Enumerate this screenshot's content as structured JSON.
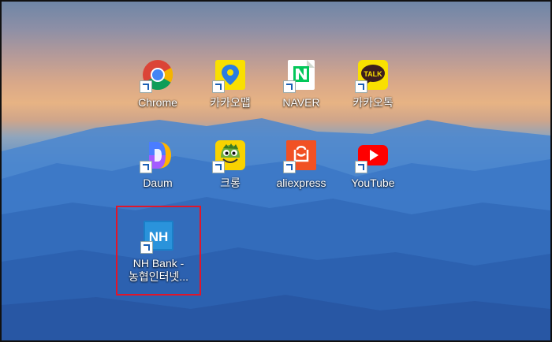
{
  "desktop": {
    "icons": [
      {
        "label": "Chrome",
        "icon": "chrome-icon"
      },
      {
        "label": "카카오맵",
        "icon": "kakaomap-icon"
      },
      {
        "label": "NAVER",
        "icon": "naver-icon"
      },
      {
        "label": "카카오톡",
        "icon": "kakaotalk-icon",
        "badge_text": "TALK"
      },
      {
        "label": "Daum",
        "icon": "daum-icon"
      },
      {
        "label": "크롱",
        "icon": "crong-icon"
      },
      {
        "label": "aliexpress",
        "icon": "aliexpress-icon"
      },
      {
        "label": "YouTube",
        "icon": "youtube-icon"
      },
      {
        "label_line1": "NH Bank -",
        "label_line2": "농협인터넷...",
        "icon": "nh-bank-icon",
        "logo_text": "NH"
      }
    ]
  },
  "colors": {
    "highlight_border": "#e0162b",
    "kakao_yellow": "#f9e000",
    "naver_green": "#03c75a",
    "youtube_red": "#ff0000"
  }
}
